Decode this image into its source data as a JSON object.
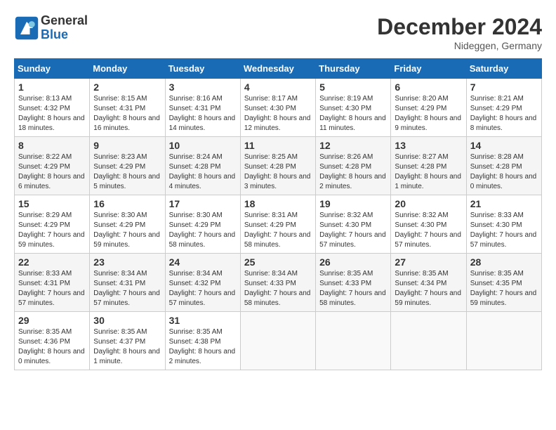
{
  "header": {
    "logo_line1": "General",
    "logo_line2": "Blue",
    "month": "December 2024",
    "location": "Nideggen, Germany"
  },
  "days_of_week": [
    "Sunday",
    "Monday",
    "Tuesday",
    "Wednesday",
    "Thursday",
    "Friday",
    "Saturday"
  ],
  "weeks": [
    [
      {
        "day": 1,
        "info": "Sunrise: 8:13 AM\nSunset: 4:32 PM\nDaylight: 8 hours and 18 minutes."
      },
      {
        "day": 2,
        "info": "Sunrise: 8:15 AM\nSunset: 4:31 PM\nDaylight: 8 hours and 16 minutes."
      },
      {
        "day": 3,
        "info": "Sunrise: 8:16 AM\nSunset: 4:31 PM\nDaylight: 8 hours and 14 minutes."
      },
      {
        "day": 4,
        "info": "Sunrise: 8:17 AM\nSunset: 4:30 PM\nDaylight: 8 hours and 12 minutes."
      },
      {
        "day": 5,
        "info": "Sunrise: 8:19 AM\nSunset: 4:30 PM\nDaylight: 8 hours and 11 minutes."
      },
      {
        "day": 6,
        "info": "Sunrise: 8:20 AM\nSunset: 4:29 PM\nDaylight: 8 hours and 9 minutes."
      },
      {
        "day": 7,
        "info": "Sunrise: 8:21 AM\nSunset: 4:29 PM\nDaylight: 8 hours and 8 minutes."
      }
    ],
    [
      {
        "day": 8,
        "info": "Sunrise: 8:22 AM\nSunset: 4:29 PM\nDaylight: 8 hours and 6 minutes."
      },
      {
        "day": 9,
        "info": "Sunrise: 8:23 AM\nSunset: 4:29 PM\nDaylight: 8 hours and 5 minutes."
      },
      {
        "day": 10,
        "info": "Sunrise: 8:24 AM\nSunset: 4:28 PM\nDaylight: 8 hours and 4 minutes."
      },
      {
        "day": 11,
        "info": "Sunrise: 8:25 AM\nSunset: 4:28 PM\nDaylight: 8 hours and 3 minutes."
      },
      {
        "day": 12,
        "info": "Sunrise: 8:26 AM\nSunset: 4:28 PM\nDaylight: 8 hours and 2 minutes."
      },
      {
        "day": 13,
        "info": "Sunrise: 8:27 AM\nSunset: 4:28 PM\nDaylight: 8 hours and 1 minute."
      },
      {
        "day": 14,
        "info": "Sunrise: 8:28 AM\nSunset: 4:28 PM\nDaylight: 8 hours and 0 minutes."
      }
    ],
    [
      {
        "day": 15,
        "info": "Sunrise: 8:29 AM\nSunset: 4:29 PM\nDaylight: 7 hours and 59 minutes."
      },
      {
        "day": 16,
        "info": "Sunrise: 8:30 AM\nSunset: 4:29 PM\nDaylight: 7 hours and 59 minutes."
      },
      {
        "day": 17,
        "info": "Sunrise: 8:30 AM\nSunset: 4:29 PM\nDaylight: 7 hours and 58 minutes."
      },
      {
        "day": 18,
        "info": "Sunrise: 8:31 AM\nSunset: 4:29 PM\nDaylight: 7 hours and 58 minutes."
      },
      {
        "day": 19,
        "info": "Sunrise: 8:32 AM\nSunset: 4:30 PM\nDaylight: 7 hours and 57 minutes."
      },
      {
        "day": 20,
        "info": "Sunrise: 8:32 AM\nSunset: 4:30 PM\nDaylight: 7 hours and 57 minutes."
      },
      {
        "day": 21,
        "info": "Sunrise: 8:33 AM\nSunset: 4:30 PM\nDaylight: 7 hours and 57 minutes."
      }
    ],
    [
      {
        "day": 22,
        "info": "Sunrise: 8:33 AM\nSunset: 4:31 PM\nDaylight: 7 hours and 57 minutes."
      },
      {
        "day": 23,
        "info": "Sunrise: 8:34 AM\nSunset: 4:31 PM\nDaylight: 7 hours and 57 minutes."
      },
      {
        "day": 24,
        "info": "Sunrise: 8:34 AM\nSunset: 4:32 PM\nDaylight: 7 hours and 57 minutes."
      },
      {
        "day": 25,
        "info": "Sunrise: 8:34 AM\nSunset: 4:33 PM\nDaylight: 7 hours and 58 minutes."
      },
      {
        "day": 26,
        "info": "Sunrise: 8:35 AM\nSunset: 4:33 PM\nDaylight: 7 hours and 58 minutes."
      },
      {
        "day": 27,
        "info": "Sunrise: 8:35 AM\nSunset: 4:34 PM\nDaylight: 7 hours and 59 minutes."
      },
      {
        "day": 28,
        "info": "Sunrise: 8:35 AM\nSunset: 4:35 PM\nDaylight: 7 hours and 59 minutes."
      }
    ],
    [
      {
        "day": 29,
        "info": "Sunrise: 8:35 AM\nSunset: 4:36 PM\nDaylight: 8 hours and 0 minutes."
      },
      {
        "day": 30,
        "info": "Sunrise: 8:35 AM\nSunset: 4:37 PM\nDaylight: 8 hours and 1 minute."
      },
      {
        "day": 31,
        "info": "Sunrise: 8:35 AM\nSunset: 4:38 PM\nDaylight: 8 hours and 2 minutes."
      },
      null,
      null,
      null,
      null
    ]
  ]
}
